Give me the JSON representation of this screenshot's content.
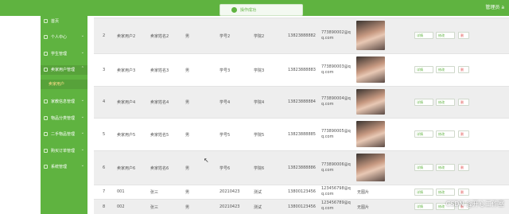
{
  "header": {
    "admin_label": "管理员 a"
  },
  "toast": {
    "message": "操作成功"
  },
  "sidebar": {
    "items": [
      {
        "label": "首页",
        "chevron": ""
      },
      {
        "label": "个人中心",
        "chevron": "⌄"
      },
      {
        "label": "学生管理",
        "chevron": "⌄"
      },
      {
        "label": "卖家用户管理",
        "chevron": "⌃"
      },
      {
        "label": "卖家用户",
        "chevron": ""
      },
      {
        "label": "家教信息管理",
        "chevron": "⌄"
      },
      {
        "label": "物品分类管理",
        "chevron": "⌄"
      },
      {
        "label": "二手物品管理",
        "chevron": "⌄"
      },
      {
        "label": "购买订单管理",
        "chevron": "⌄"
      },
      {
        "label": "系统管理",
        "chevron": "⌄"
      }
    ]
  },
  "table": {
    "buttons": {
      "detail": "详情",
      "edit": "修改",
      "delete": "删"
    },
    "rows": [
      {
        "index": "2",
        "account": "卖家用户2",
        "name": "卖家姓名2",
        "gender": "男",
        "student_id": "学号2",
        "college": "学院2",
        "phone": "13823888882",
        "email": "773890002@qq.com",
        "photo": "photo"
      },
      {
        "index": "3",
        "account": "卖家用户3",
        "name": "卖家姓名3",
        "gender": "男",
        "student_id": "学号3",
        "college": "学院3",
        "phone": "13823888883",
        "email": "773890003@qq.com",
        "photo": "photo"
      },
      {
        "index": "4",
        "account": "卖家用户4",
        "name": "卖家姓名4",
        "gender": "男",
        "student_id": "学号4",
        "college": "学院4",
        "phone": "13823888884",
        "email": "773890004@qq.com",
        "photo": "photo"
      },
      {
        "index": "5",
        "account": "卖家用户5",
        "name": "卖家姓名5",
        "gender": "男",
        "student_id": "学号5",
        "college": "学院5",
        "phone": "13823888885",
        "email": "773890005@qq.com",
        "photo": "photo"
      },
      {
        "index": "6",
        "account": "卖家用户6",
        "name": "卖家姓名6",
        "gender": "男",
        "student_id": "学号6",
        "college": "学院6",
        "phone": "13823888886",
        "email": "773890006@qq.com",
        "photo": "photo"
      },
      {
        "index": "7",
        "account": "001",
        "name": "张三",
        "gender": "男",
        "student_id": "20210423",
        "college": "测试",
        "phone": "13800123456",
        "email": "123456798@qq.com",
        "photo": "无图片"
      },
      {
        "index": "8",
        "account": "002",
        "name": "张三",
        "gender": "男",
        "student_id": "20210423",
        "college": "测试",
        "phone": "13800123456",
        "email": "123456789@qq.com",
        "photo": "无图片"
      }
    ]
  },
  "watermark": "CSDN @开心工作室",
  "colors": {
    "brand_green": "#5fb340",
    "danger": "#e35b5b"
  },
  "icons": {
    "success": "check-circle-icon",
    "cursor": "mouse-cursor-icon"
  }
}
